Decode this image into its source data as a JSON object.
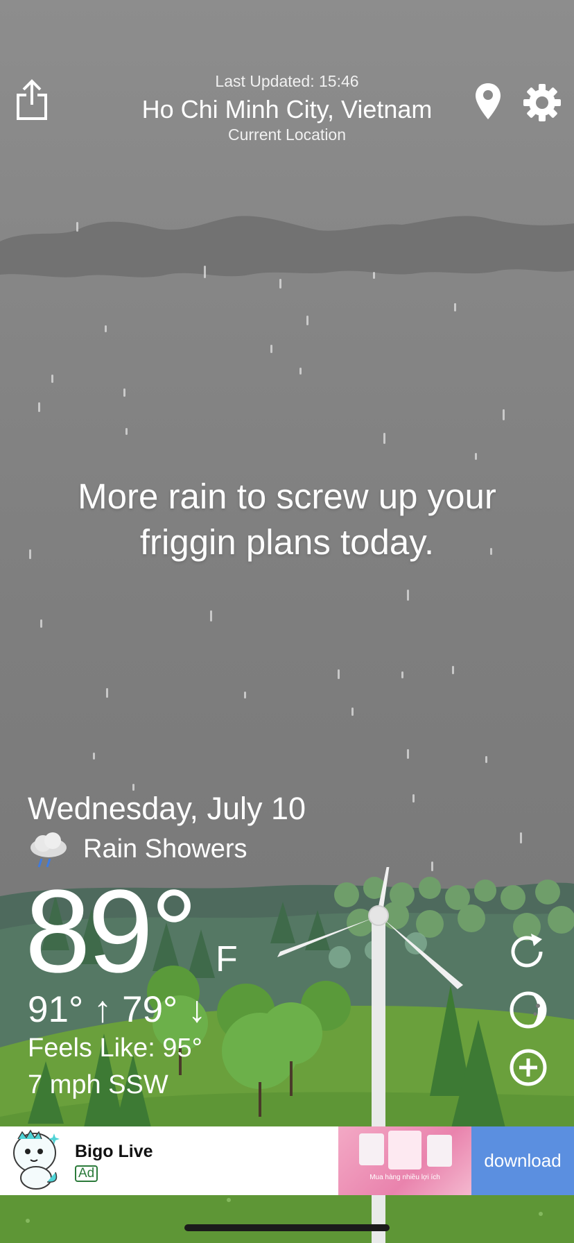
{
  "header": {
    "last_updated": "Last Updated: 15:46",
    "city": "Ho Chi Minh City, Vietnam",
    "location_label": "Current Location",
    "share_icon": "share-icon",
    "location_icon": "location-pin-icon",
    "settings_icon": "gear-icon"
  },
  "tagline": {
    "line1": "More rain to screw up your",
    "line2": "friggin plans today."
  },
  "weather": {
    "date": "Wednesday, July 10",
    "condition": "Rain Showers",
    "condition_icon": "rain-cloud-icon",
    "temperature": "89°",
    "unit": "F",
    "hi_lo": "91° ↑  79° ↓",
    "feels_like": "Feels Like: 95°",
    "wind": "7 mph SSW"
  },
  "side_actions": {
    "refresh_icon": "refresh-icon",
    "moon_icon": "moon-icon",
    "add_icon": "add-icon"
  },
  "ad": {
    "app_name": "Bigo Live",
    "badge": "Ad",
    "image_caption": "Mua hàng nhiều lợi ích",
    "cta": "download"
  },
  "colors": {
    "sky": "#7d7d7d",
    "hills": "#4f6b5e",
    "grass": "#6aa03c",
    "ad_cta": "#5b8fe0"
  }
}
